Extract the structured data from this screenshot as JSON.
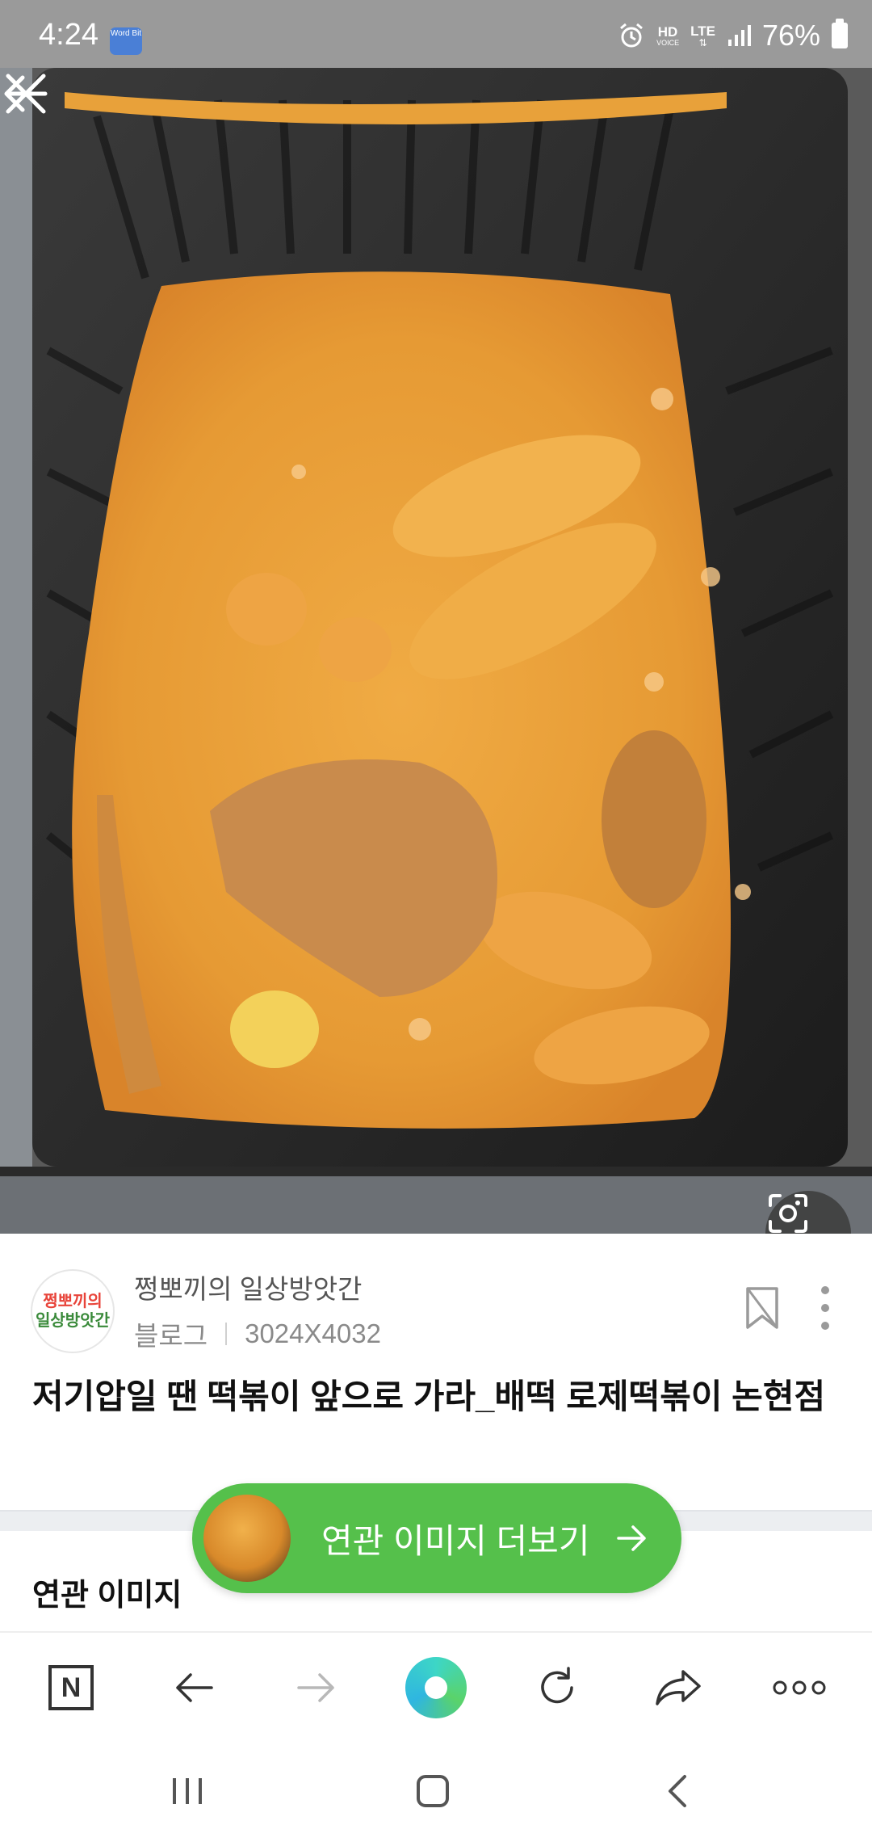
{
  "status_bar": {
    "time": "4:24",
    "app_badge": "Word Bit",
    "network_hd": "HD",
    "network_voice": "VOICE",
    "network_lte": "LTE",
    "battery": "76%"
  },
  "viewer": {
    "back_icon": "arrow-left-icon",
    "close_icon": "close-icon",
    "lens_icon": "camera-lens-icon"
  },
  "info": {
    "blog_name": "쩡뽀끼의 일상방앗간",
    "avatar_text_line1": "쩡뽀끼의",
    "avatar_text_line2": "일상방앗간",
    "source_type": "블로그",
    "resolution": "3024X4032",
    "title": "저기압일 땐 떡볶이 앞으로 가라_배떡 로제떡볶이 논현점"
  },
  "related": {
    "section_label": "연관 이미지",
    "more_button_label": "연관 이미지 더보기"
  },
  "colors": {
    "accent_green": "#55c04b",
    "sauce_orange": "#e9a23b"
  },
  "toolbar": {
    "home_glyph": "N"
  }
}
